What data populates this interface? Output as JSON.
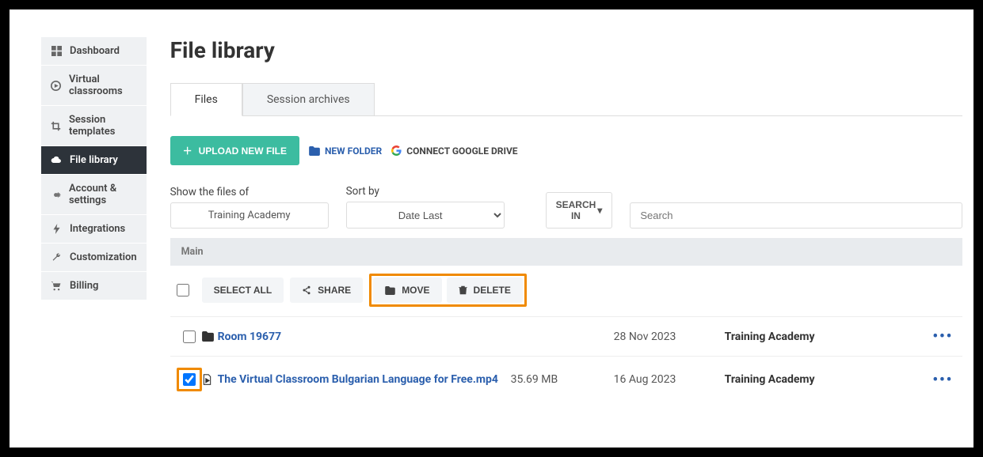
{
  "sidebar": {
    "items": [
      {
        "label": "Dashboard"
      },
      {
        "label": "Virtual classrooms"
      },
      {
        "label": "Session templates"
      },
      {
        "label": "File library"
      },
      {
        "label": "Account & settings"
      },
      {
        "label": "Integrations"
      },
      {
        "label": "Customization"
      },
      {
        "label": "Billing"
      }
    ]
  },
  "page": {
    "title": "File library"
  },
  "tabs": {
    "files": "Files",
    "archives": "Session archives"
  },
  "actions": {
    "upload": "UPLOAD NEW FILE",
    "new_folder": "NEW FOLDER",
    "connect_gdrive": "CONNECT GOOGLE DRIVE"
  },
  "filters": {
    "show_label": "Show the files of",
    "show_value": "Training Academy",
    "sort_label": "Sort by",
    "sort_value": "Date Last",
    "search_in": "SEARCH IN",
    "search_placeholder": "Search"
  },
  "breadcrumb": "Main",
  "bulk": {
    "select_all": "SELECT ALL",
    "share": "SHARE",
    "move": "MOVE",
    "delete": "DELETE"
  },
  "rows": [
    {
      "checked": false,
      "icon": "folder",
      "name": "Room 19677",
      "size": "",
      "date": "28 Nov 2023",
      "owner": "Training Academy"
    },
    {
      "checked": true,
      "icon": "video",
      "name": "The Virtual Classroom Bulgarian Language for Free.mp4",
      "size": "35.69 MB",
      "date": "16 Aug 2023",
      "owner": "Training Academy"
    }
  ]
}
